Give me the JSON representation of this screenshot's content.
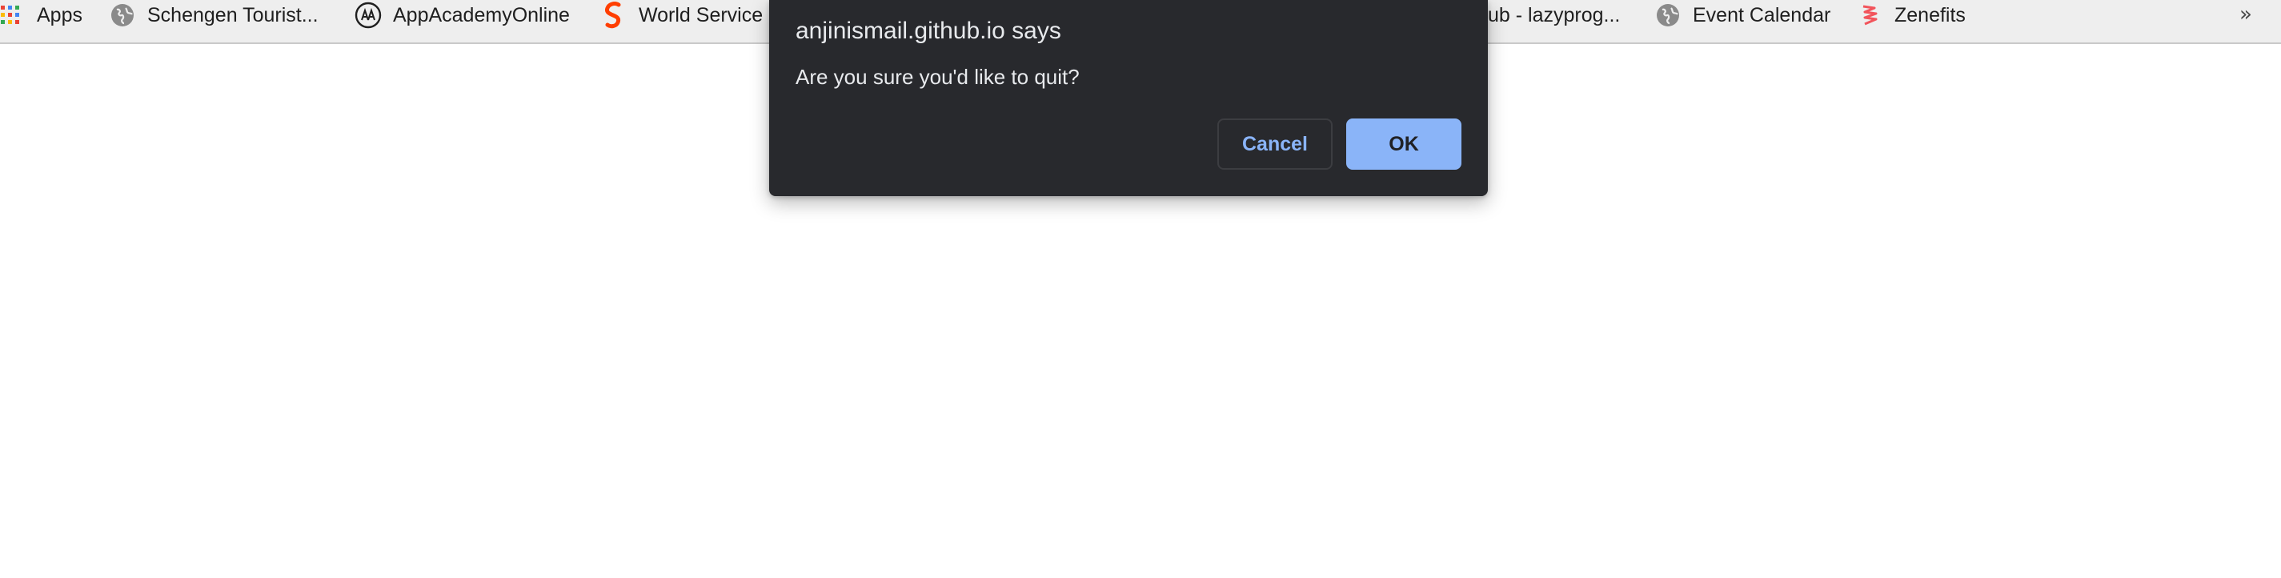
{
  "bookmarks_bar": {
    "items": [
      {
        "label": "Apps",
        "icon": "apps-grid-icon"
      },
      {
        "label": "Schengen Tourist...",
        "icon": "globe-icon"
      },
      {
        "label": "AppAcademyOnline",
        "icon": "app-academy-icon"
      },
      {
        "label": "World Service",
        "icon": "svelte-s-icon"
      },
      {
        "label": "ub - lazyprog...",
        "icon": ""
      },
      {
        "label": "Event Calendar",
        "icon": "globe-icon"
      },
      {
        "label": "Zenefits",
        "icon": "zenefits-icon"
      }
    ],
    "overflow_label": "»"
  },
  "dialog": {
    "title": "anjinismail.github.io says",
    "message": "Are you sure you'd like to quit?",
    "cancel_label": "Cancel",
    "ok_label": "OK"
  },
  "colors": {
    "dialog_bg": "#28292d",
    "dialog_text": "#e8eaed",
    "accent": "#8ab4f8",
    "bookmarks_bg": "#eeeeee"
  }
}
